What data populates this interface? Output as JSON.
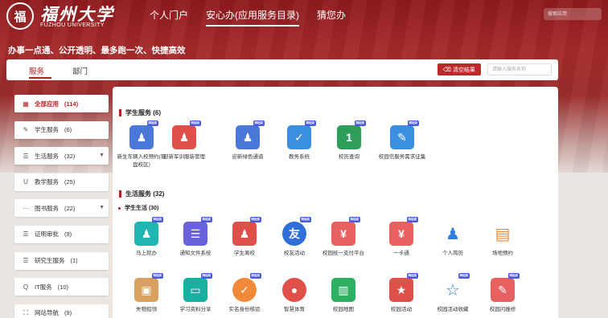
{
  "header": {
    "logo_seal": "福",
    "logo_cn": "福州大学",
    "logo_en": "FUZHOU UNIVERSITY",
    "nav": [
      {
        "label": "个人门户"
      },
      {
        "label": "安心办(应用服务目录)"
      },
      {
        "label": "猜您办"
      }
    ],
    "search_placeholder": "搜索应用"
  },
  "slogan": "办事一点通、公开透明、最多跑一次、快捷高效",
  "tabs": [
    {
      "label": "服务"
    },
    {
      "label": "部门"
    }
  ],
  "toolbar": {
    "clear_label": "清空结果",
    "search_placeholder": "请输入服务名称"
  },
  "sidebar": [
    {
      "icon": "▦",
      "label": "全部应用",
      "count": "(114)"
    },
    {
      "icon": "✎",
      "label": "学生服务",
      "count": "(6)"
    },
    {
      "icon": "☰",
      "label": "生活服务",
      "count": "(32)",
      "arrow": "▼"
    },
    {
      "icon": "U",
      "label": "教学服务",
      "count": "(25)"
    },
    {
      "icon": "⋯",
      "label": "图书服务",
      "count": "(22)",
      "arrow": "▼"
    },
    {
      "icon": "☰",
      "label": "证明审批",
      "count": "(9)"
    },
    {
      "icon": "☰",
      "label": "研究生服务",
      "count": "(1)"
    },
    {
      "icon": "Q",
      "label": "IT服务",
      "count": "(10)"
    },
    {
      "icon": "⛶",
      "label": "网站导航",
      "count": "(9)"
    }
  ],
  "sections": {
    "student": {
      "title": "学生服务 (6)",
      "apps": [
        {
          "name": "新生车辆入校预约(铜盘校区)",
          "color": "#4a78d8",
          "glyph": "♟",
          "badge": "网站类"
        },
        {
          "name": "迎新军训服装管理",
          "color": "#e0504a",
          "glyph": "♟",
          "badge": "网站类"
        },
        {
          "name": "迎新绿色通道",
          "color": "#4a78d8",
          "glyph": "♟",
          "badge": "网站类"
        },
        {
          "name": "教务系统",
          "color": "#3a8fe0",
          "glyph": "✓",
          "badge": "网站类"
        },
        {
          "name": "校历查询",
          "color": "#2e9e5a",
          "glyph": "1",
          "badge": "网站类"
        },
        {
          "name": "校园信服务需求征集",
          "color": "#3a8fe0",
          "glyph": "✎",
          "badge": "网站类"
        }
      ]
    },
    "life": {
      "title": "生活服务 (32)",
      "sub_title": "学生生活 (30)",
      "apps": [
        {
          "name": "马上就办",
          "color": "#1fb5b0",
          "glyph": "♟",
          "badge": "网站类"
        },
        {
          "name": "通知文件系统",
          "color": "#6a62d8",
          "glyph": "☰",
          "badge": "网站类"
        },
        {
          "name": "学生离校",
          "color": "#e0504a",
          "glyph": "♟",
          "badge": "网站类"
        },
        {
          "name": "校友活动",
          "color": "#2f6fd8",
          "glyph": "友",
          "badge": "网站类",
          "round": true
        },
        {
          "name": "校园统一支付平台",
          "color": "#e86060",
          "glyph": "¥",
          "badge": "网站类"
        },
        {
          "name": "一卡通",
          "color": "#e86060",
          "glyph": "¥",
          "badge": "网站类"
        },
        {
          "name": "个人简历",
          "color": "#2f7fe0",
          "glyph": "♟",
          "plain": true
        },
        {
          "name": "场地预约",
          "color": "#f08a3a",
          "glyph": "▤",
          "plain": true
        },
        {
          "name": "失物招领",
          "color": "#d9a060",
          "glyph": "▣",
          "badge": "网站类"
        },
        {
          "name": "学习资料分享",
          "color": "#18b0a0",
          "glyph": "▭",
          "badge": "网站类"
        },
        {
          "name": "实名身份核验",
          "color": "#f08a3a",
          "glyph": "✓",
          "badge": "网站类",
          "round": true
        },
        {
          "name": "智慧体育",
          "color": "#e0504a",
          "glyph": "●",
          "round": true
        },
        {
          "name": "校园地图",
          "color": "#2eb062",
          "glyph": "▥"
        },
        {
          "name": "校园活动",
          "color": "#e0504a",
          "glyph": "★",
          "badge": "网站类"
        },
        {
          "name": "校园活动收藏",
          "color": "#2f7fe0",
          "glyph": "☆",
          "badge": "网站类",
          "plain": true
        },
        {
          "name": "校园问报修",
          "color": "#e86060",
          "glyph": "✎",
          "badge": "网站类"
        }
      ]
    }
  }
}
